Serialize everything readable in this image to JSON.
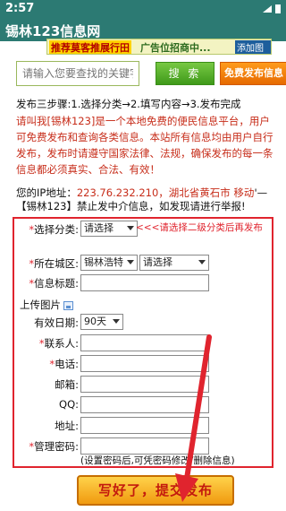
{
  "status": {
    "time": "2:57"
  },
  "app": {
    "title": "锡林123信息网"
  },
  "banner": {
    "left_text": "推荐莫客推展行田",
    "center_text": "广告位招商中...",
    "right_text": "添加图像"
  },
  "search": {
    "placeholder": "请输入您要查找的关键字",
    "button_label": "搜 索",
    "publish_label": "免费发布信息"
  },
  "steps": "发布三步骤:1.选择分类→2.填写内容→3.发布完成",
  "intro": "请叫我[锡林123]是一个本地免费的便民信息平台，用户可免费发布和查询各类信息。本站所有信息均由用户自行发布，发布时请遵守国家法律、法规，确保发布的每一条信息都必须真实、合法、有效！",
  "ip": {
    "label": "您的IP地址：",
    "address": "223.76.232.210，湖北省黄石市 移动",
    "suffix": "'—【锡林123】禁止发中介信息，如发现请进行举报!"
  },
  "form": {
    "category": {
      "label": "选择分类:",
      "value": "请选择",
      "hint": "<<<请选择二级分类后再发布"
    },
    "district": {
      "label": "所在城区:",
      "value1": "锡林浩特",
      "value2": "请选择"
    },
    "title": {
      "label": "信息标题:",
      "value": ""
    },
    "upload": {
      "label": "上传图片"
    },
    "validity": {
      "label": "有效日期:",
      "value": "90天"
    },
    "contact": {
      "label": "联系人:",
      "value": ""
    },
    "phone": {
      "label": "电话:",
      "value": ""
    },
    "email": {
      "label": "邮箱:",
      "value": ""
    },
    "qq": {
      "label": "QQ:",
      "value": ""
    },
    "address": {
      "label": "地址:",
      "value": ""
    },
    "password": {
      "label": "管理密码:",
      "value": "",
      "note": "(设置密码后,可凭密码修改/删除信息)"
    },
    "required_mark": "*"
  },
  "submit": {
    "label": "写好了，提交发布"
  },
  "colors": {
    "header": "#2c7a73",
    "accent_red": "#e0242e",
    "search_green": "#3f9a1a",
    "publish_orange": "#e66a00"
  }
}
